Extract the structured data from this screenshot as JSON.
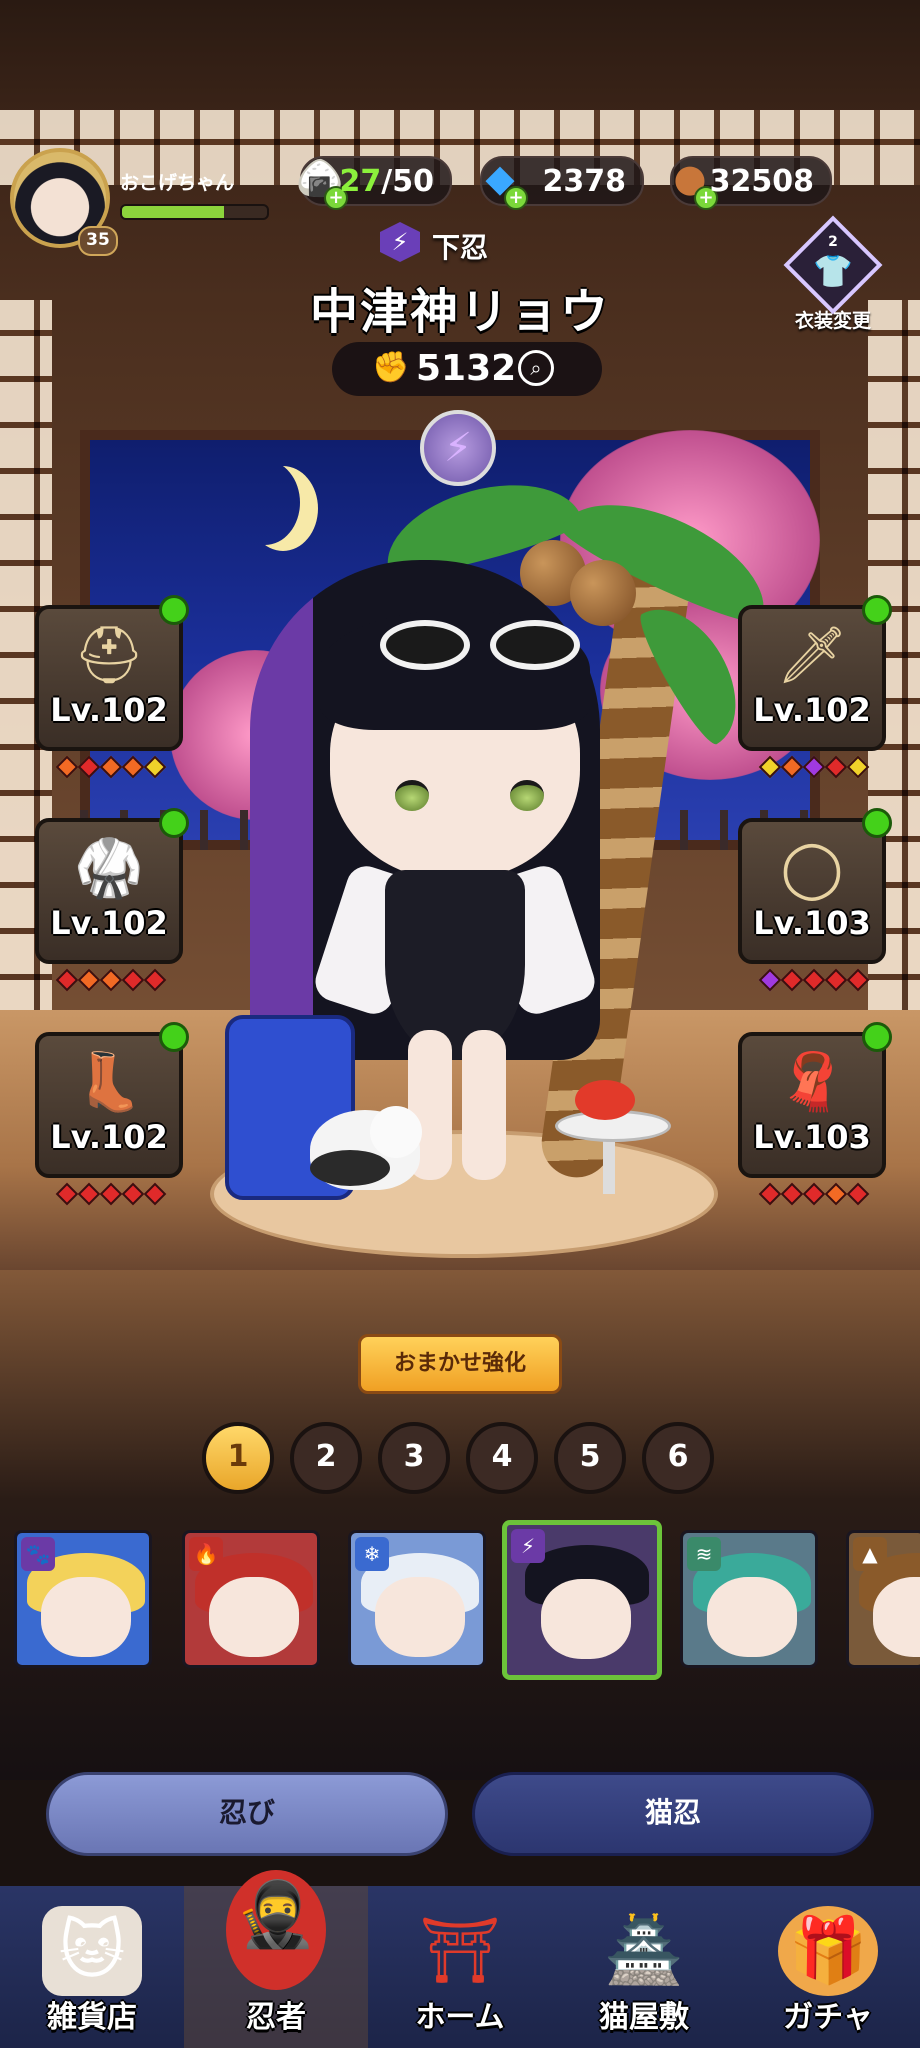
{
  "player": {
    "name": "おこげちゃん",
    "level": "35",
    "exp_ratio": 0.7
  },
  "resources": {
    "stamina": {
      "current": "27",
      "max": "/50",
      "icon": "onigiri-icon"
    },
    "gems": {
      "value": "2378",
      "icon": "crystal-icon"
    },
    "coins": {
      "value": "32508",
      "icon": "coin-icon"
    }
  },
  "costume": {
    "label": "衣装変更",
    "count": "2",
    "icon": "shirt-icon"
  },
  "character": {
    "rank": "下忍",
    "name": "中津神リョウ",
    "power": "5132",
    "element_icon": "lightning-icon"
  },
  "equipment": {
    "left": [
      {
        "level": "Lv.102",
        "icon": "headband-icon",
        "gems": [
          "orange",
          "red",
          "orange",
          "orange",
          "yellow"
        ]
      },
      {
        "level": "Lv.102",
        "icon": "armor-icon",
        "gems": [
          "red",
          "orange",
          "orange",
          "red",
          "red"
        ]
      },
      {
        "level": "Lv.102",
        "icon": "boots-icon",
        "gems": [
          "red",
          "red",
          "red",
          "red",
          "red"
        ]
      }
    ],
    "right": [
      {
        "level": "Lv.102",
        "icon": "kunai-icon",
        "gems": [
          "yellow",
          "orange",
          "purple",
          "red",
          "yellow"
        ]
      },
      {
        "level": "Lv.103",
        "icon": "bracelet-icon",
        "gems": [
          "purple",
          "red",
          "red",
          "red",
          "red"
        ]
      },
      {
        "level": "Lv.103",
        "icon": "scarf-icon",
        "gems": [
          "red",
          "red",
          "red",
          "orange",
          "red"
        ]
      }
    ]
  },
  "auto_enhance_label": "おまかせ強化",
  "teams": [
    "1",
    "2",
    "3",
    "4",
    "5",
    "6"
  ],
  "active_team": "1",
  "roster": [
    {
      "element": "paw",
      "glyph": "🐾",
      "badge_color": "#6b3aa6",
      "hair_color": "#f3d25a",
      "selected": false
    },
    {
      "element": "fire",
      "glyph": "🔥",
      "badge_color": "#c0302a",
      "hair_color": "#c0302a",
      "selected": false
    },
    {
      "element": "ice",
      "glyph": "❄",
      "badge_color": "#3a6ad0",
      "hair_color": "#e8eef6",
      "selected": false
    },
    {
      "element": "lightning",
      "glyph": "⚡",
      "badge_color": "#6b3aa6",
      "hair_color": "#141420",
      "selected": true
    },
    {
      "element": "wind",
      "glyph": "≋",
      "badge_color": "#3a8a6a",
      "hair_color": "#3aaa9a",
      "selected": false
    },
    {
      "element": "earth",
      "glyph": "▲",
      "badge_color": "#8a5a2a",
      "hair_color": "#8a5a2a",
      "selected": false
    }
  ],
  "tabs": {
    "shinobi": "忍び",
    "nekonin": "猫忍"
  },
  "nav": [
    {
      "label": "雑貨店",
      "icon": "shop-cat-icon",
      "glyph": "🐱"
    },
    {
      "label": "忍者",
      "icon": "ninja-icon",
      "glyph": "🥷"
    },
    {
      "label": "ホーム",
      "icon": "torii-icon",
      "glyph": "⛩"
    },
    {
      "label": "猫屋敷",
      "icon": "mansion-icon",
      "glyph": "🏯"
    },
    {
      "label": "ガチャ",
      "icon": "gacha-icon",
      "glyph": "🎁"
    }
  ],
  "active_nav": "忍者"
}
